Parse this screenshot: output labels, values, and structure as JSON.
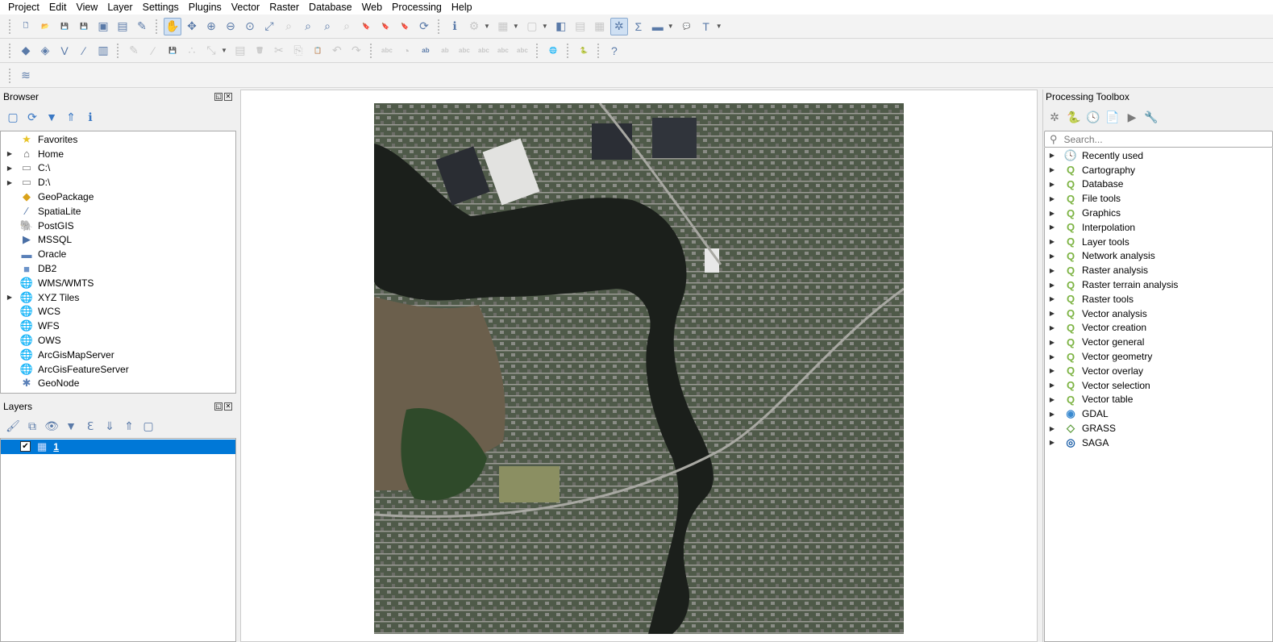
{
  "menu": [
    "Project",
    "Edit",
    "View",
    "Layer",
    "Settings",
    "Plugins",
    "Vector",
    "Raster",
    "Database",
    "Web",
    "Processing",
    "Help"
  ],
  "toolbar1": [
    {
      "icon": "new-project-icon",
      "g": "🗋"
    },
    {
      "icon": "open-project-icon",
      "g": "📂"
    },
    {
      "icon": "save-project-icon",
      "g": "💾"
    },
    {
      "icon": "save-as-icon",
      "g": "💾"
    },
    {
      "icon": "new-print-layout-icon",
      "g": "▣"
    },
    {
      "icon": "layout-manager-icon",
      "g": "▤"
    },
    {
      "icon": "style-manager-icon",
      "g": "✎"
    },
    {
      "sep": true
    },
    {
      "icon": "pan-icon",
      "g": "✋",
      "on": true
    },
    {
      "icon": "pan-to-selection-icon",
      "g": "✥"
    },
    {
      "icon": "zoom-in-icon",
      "g": "⊕"
    },
    {
      "icon": "zoom-out-icon",
      "g": "⊖"
    },
    {
      "icon": "zoom-native-icon",
      "g": "⊙"
    },
    {
      "icon": "zoom-full-icon",
      "g": "⤢"
    },
    {
      "icon": "zoom-to-selection-icon",
      "g": "⌕",
      "dis": true
    },
    {
      "icon": "zoom-to-layer-icon",
      "g": "⌕"
    },
    {
      "icon": "zoom-last-icon",
      "g": "⌕"
    },
    {
      "icon": "zoom-next-icon",
      "g": "⌕",
      "dis": true
    },
    {
      "icon": "new-bookmark-icon",
      "g": "🔖"
    },
    {
      "icon": "show-bookmarks-icon",
      "g": "🔖"
    },
    {
      "icon": "spatial-bookmarks-icon",
      "g": "🔖"
    },
    {
      "icon": "refresh-icon",
      "g": "⟳"
    },
    {
      "sep": true
    },
    {
      "icon": "identify-icon",
      "g": "ℹ"
    },
    {
      "icon": "select-by-location-icon",
      "g": "⚙",
      "dis": true,
      "dd": true
    },
    {
      "icon": "select-features-icon",
      "g": "▦",
      "dis": true,
      "dd": true
    },
    {
      "icon": "deselect-icon",
      "g": "▢",
      "dis": true,
      "dd": true
    },
    {
      "icon": "deselect-all-icon",
      "g": "◧"
    },
    {
      "icon": "attribute-table-icon",
      "g": "▤",
      "dis": true
    },
    {
      "icon": "field-calculator-icon",
      "g": "▦",
      "dis": true
    },
    {
      "icon": "processing-toolbox-icon",
      "g": "✲",
      "on": true
    },
    {
      "icon": "statistics-icon",
      "g": "Σ"
    },
    {
      "icon": "measure-icon",
      "g": "▬",
      "dd": true
    },
    {
      "icon": "map-tips-icon",
      "g": "💬"
    },
    {
      "icon": "text-annotation-icon",
      "g": "T",
      "dd": true
    }
  ],
  "toolbar2": [
    {
      "icon": "data-source-manager-icon",
      "g": "◆"
    },
    {
      "icon": "new-geopackage-layer-icon",
      "g": "◈"
    },
    {
      "icon": "new-shapefile-layer-icon",
      "g": "V"
    },
    {
      "icon": "new-spatialite-layer-icon",
      "g": "∕"
    },
    {
      "icon": "new-temporary-layer-icon",
      "g": "▥"
    },
    {
      "sep": true
    },
    {
      "icon": "current-edits-icon",
      "g": "✎",
      "dis": true
    },
    {
      "icon": "toggle-editing-icon",
      "g": "∕",
      "dis": true
    },
    {
      "icon": "save-edits-icon",
      "g": "💾",
      "dis": true
    },
    {
      "icon": "add-feature-icon",
      "g": "∴",
      "dis": true
    },
    {
      "icon": "vertex-tool-icon",
      "g": "⤡",
      "dis": true,
      "dd": true
    },
    {
      "icon": "modify-attributes-icon",
      "g": "▤",
      "dis": true
    },
    {
      "icon": "delete-icon",
      "g": "🗑",
      "dis": true
    },
    {
      "icon": "cut-icon",
      "g": "✂",
      "dis": true
    },
    {
      "icon": "copy-icon",
      "g": "⎘",
      "dis": true
    },
    {
      "icon": "paste-icon",
      "g": "📋",
      "dis": true
    },
    {
      "icon": "undo-icon",
      "g": "↶",
      "dis": true
    },
    {
      "icon": "redo-icon",
      "g": "↷",
      "dis": true
    },
    {
      "sep": true
    },
    {
      "icon": "label-icon",
      "g": "abc",
      "dis": true
    },
    {
      "icon": "diagram-icon",
      "g": "◔",
      "dis": true
    },
    {
      "icon": "layer-labeling-icon",
      "g": "ab"
    },
    {
      "icon": "pin-labels-icon",
      "g": "ab",
      "dis": true
    },
    {
      "icon": "show-labels-icon",
      "g": "abc",
      "dis": true
    },
    {
      "icon": "move-label-icon",
      "g": "abc",
      "dis": true
    },
    {
      "icon": "rotate-label-icon",
      "g": "abc",
      "dis": true
    },
    {
      "icon": "change-label-icon",
      "g": "abc",
      "dis": true
    },
    {
      "sep": true
    },
    {
      "icon": "plugin-globe-icon",
      "g": "🌐"
    },
    {
      "sep": true
    },
    {
      "icon": "python-console-icon",
      "g": "🐍"
    },
    {
      "sep": true
    },
    {
      "icon": "help-icon",
      "g": "?"
    }
  ],
  "toolbar3": [
    {
      "icon": "layers-panel-icon",
      "g": "≋"
    }
  ],
  "browser": {
    "title": "Browser",
    "toolbar": [
      {
        "icon": "add-selected-layers-icon",
        "g": "▢"
      },
      {
        "icon": "refresh-icon",
        "g": "⟳"
      },
      {
        "icon": "filter-icon",
        "g": "▼"
      },
      {
        "icon": "collapse-all-icon",
        "g": "⇑"
      },
      {
        "icon": "properties-icon",
        "g": "ℹ"
      }
    ],
    "items": [
      {
        "label": "Favorites",
        "icon": "star-icon",
        "g": "★",
        "c": "#e8c42a",
        "exp": false
      },
      {
        "label": "Home",
        "icon": "home-folder-icon",
        "g": "⌂",
        "c": "#555",
        "exp": true
      },
      {
        "label": "C:\\",
        "icon": "folder-icon",
        "g": "▭",
        "c": "#888",
        "exp": true
      },
      {
        "label": "D:\\",
        "icon": "folder-icon",
        "g": "▭",
        "c": "#888",
        "exp": true
      },
      {
        "label": "GeoPackage",
        "icon": "geopackage-icon",
        "g": "◆",
        "c": "#d9a21b",
        "exp": false
      },
      {
        "label": "SpatiaLite",
        "icon": "feather-icon",
        "g": "∕",
        "c": "#4a6fa5",
        "exp": false
      },
      {
        "label": "PostGIS",
        "icon": "elephant-icon",
        "g": "🐘",
        "c": "#4a6fa5",
        "exp": false
      },
      {
        "label": "MSSQL",
        "icon": "mssql-icon",
        "g": "▶",
        "c": "#4a6fa5",
        "exp": false
      },
      {
        "label": "Oracle",
        "icon": "oracle-icon",
        "g": "▬",
        "c": "#5a80b8",
        "exp": false
      },
      {
        "label": "DB2",
        "icon": "db2-icon",
        "g": "■",
        "c": "#6b93c9",
        "exp": false
      },
      {
        "label": "WMS/WMTS",
        "icon": "globe-icon",
        "g": "🌐",
        "c": "#4a6fa5",
        "exp": false
      },
      {
        "label": "XYZ Tiles",
        "icon": "globe-icon",
        "g": "🌐",
        "c": "#4a6fa5",
        "exp": true
      },
      {
        "label": "WCS",
        "icon": "globe-icon",
        "g": "🌐",
        "c": "#4a6fa5",
        "exp": false
      },
      {
        "label": "WFS",
        "icon": "globe-icon",
        "g": "🌐",
        "c": "#4a6fa5",
        "exp": false
      },
      {
        "label": "OWS",
        "icon": "globe-icon",
        "g": "🌐",
        "c": "#8ab",
        "exp": false
      },
      {
        "label": "ArcGisMapServer",
        "icon": "arcgis-globe-icon",
        "g": "🌐",
        "c": "#4a6fa5",
        "exp": false
      },
      {
        "label": "ArcGisFeatureServer",
        "icon": "arcgis-globe-icon",
        "g": "🌐",
        "c": "#4a6fa5",
        "exp": false
      },
      {
        "label": "GeoNode",
        "icon": "geonode-icon",
        "g": "✱",
        "c": "#5a80b8",
        "exp": false
      }
    ]
  },
  "layers": {
    "title": "Layers",
    "toolbar": [
      {
        "icon": "style-icon",
        "g": "🖌"
      },
      {
        "icon": "add-group-icon",
        "g": "⧉"
      },
      {
        "icon": "visibility-icon",
        "g": "👁"
      },
      {
        "icon": "filter-legend-icon",
        "g": "▼"
      },
      {
        "icon": "expression-filter-icon",
        "g": "ℇ"
      },
      {
        "icon": "expand-all-icon",
        "g": "⇓"
      },
      {
        "icon": "collapse-all-icon",
        "g": "⇑"
      },
      {
        "icon": "remove-layer-icon",
        "g": "▢"
      }
    ],
    "items": [
      {
        "label": "1",
        "checked": true
      }
    ]
  },
  "toolbox": {
    "title": "Processing Toolbox",
    "toolbar": [
      {
        "icon": "models-icon",
        "g": "✲"
      },
      {
        "icon": "scripts-icon",
        "g": "🐍"
      },
      {
        "icon": "history-icon",
        "g": "🕓"
      },
      {
        "icon": "results-viewer-icon",
        "g": "📄"
      },
      {
        "icon": "edit-features-in-place-icon",
        "g": "▶"
      },
      {
        "icon": "options-icon",
        "g": "🔧"
      }
    ],
    "search_placeholder": "Search...",
    "items": [
      {
        "label": "Recently used",
        "icon": "clock-icon",
        "g": "🕓",
        "c": "#888"
      },
      {
        "label": "Cartography",
        "icon": "qgis-icon",
        "g": "Q",
        "c": "#7cb342"
      },
      {
        "label": "Database",
        "icon": "qgis-icon",
        "g": "Q",
        "c": "#7cb342"
      },
      {
        "label": "File tools",
        "icon": "qgis-icon",
        "g": "Q",
        "c": "#7cb342"
      },
      {
        "label": "Graphics",
        "icon": "qgis-icon",
        "g": "Q",
        "c": "#7cb342"
      },
      {
        "label": "Interpolation",
        "icon": "qgis-icon",
        "g": "Q",
        "c": "#7cb342"
      },
      {
        "label": "Layer tools",
        "icon": "qgis-icon",
        "g": "Q",
        "c": "#7cb342"
      },
      {
        "label": "Network analysis",
        "icon": "qgis-icon",
        "g": "Q",
        "c": "#7cb342"
      },
      {
        "label": "Raster analysis",
        "icon": "qgis-icon",
        "g": "Q",
        "c": "#7cb342"
      },
      {
        "label": "Raster terrain analysis",
        "icon": "qgis-icon",
        "g": "Q",
        "c": "#7cb342"
      },
      {
        "label": "Raster tools",
        "icon": "qgis-icon",
        "g": "Q",
        "c": "#7cb342"
      },
      {
        "label": "Vector analysis",
        "icon": "qgis-icon",
        "g": "Q",
        "c": "#7cb342"
      },
      {
        "label": "Vector creation",
        "icon": "qgis-icon",
        "g": "Q",
        "c": "#7cb342"
      },
      {
        "label": "Vector general",
        "icon": "qgis-icon",
        "g": "Q",
        "c": "#7cb342"
      },
      {
        "label": "Vector geometry",
        "icon": "qgis-icon",
        "g": "Q",
        "c": "#7cb342"
      },
      {
        "label": "Vector overlay",
        "icon": "qgis-icon",
        "g": "Q",
        "c": "#7cb342"
      },
      {
        "label": "Vector selection",
        "icon": "qgis-icon",
        "g": "Q",
        "c": "#7cb342"
      },
      {
        "label": "Vector table",
        "icon": "qgis-icon",
        "g": "Q",
        "c": "#7cb342"
      },
      {
        "label": "GDAL",
        "icon": "gdal-icon",
        "g": "◉",
        "c": "#3a8ad0"
      },
      {
        "label": "GRASS",
        "icon": "grass-icon",
        "g": "◇",
        "c": "#5a9a3a"
      },
      {
        "label": "SAGA",
        "icon": "saga-icon",
        "g": "◎",
        "c": "#1c5fa8"
      }
    ]
  },
  "colors": {
    "selection": "#0078d7",
    "water": "#1c1f1c"
  }
}
